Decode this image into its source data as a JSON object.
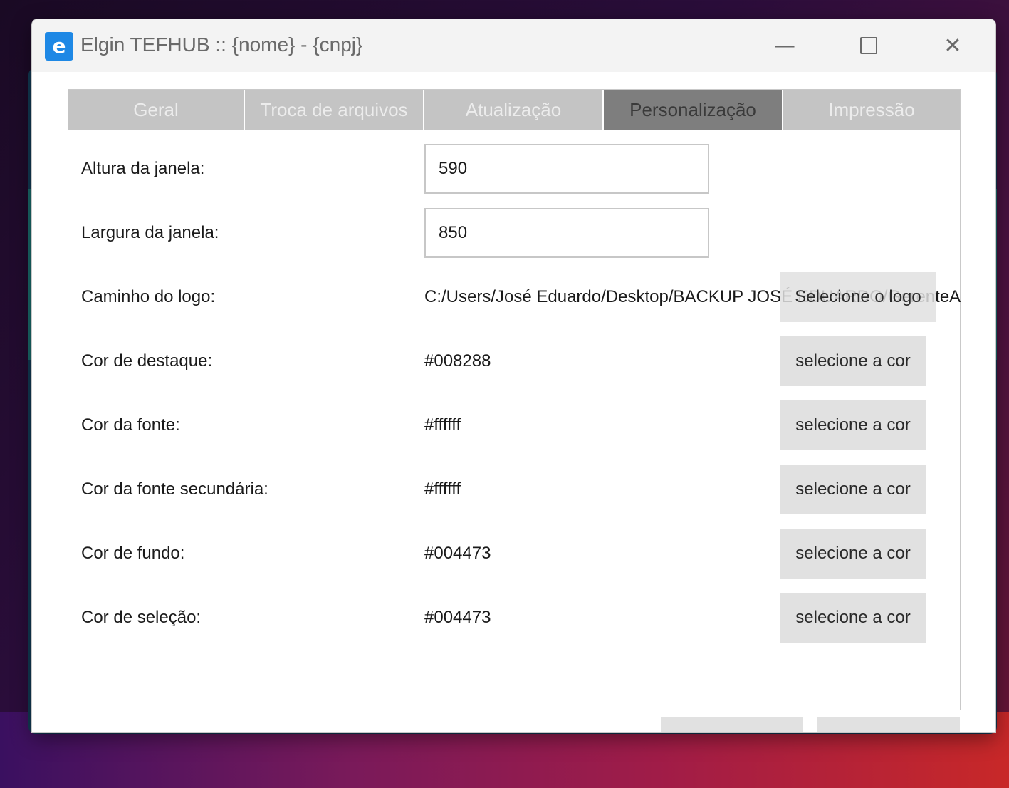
{
  "window": {
    "app_icon_letter": "e",
    "title": "Elgin TEFHUB :: {nome} - {cnpj}",
    "controls": {
      "minimize": "—",
      "close": "✕"
    }
  },
  "tabs": [
    {
      "label": "Geral",
      "active": false
    },
    {
      "label": "Troca de arquivos",
      "active": false
    },
    {
      "label": "Atualização",
      "active": false
    },
    {
      "label": "Personalização",
      "active": true
    },
    {
      "label": "Impressão",
      "active": false
    }
  ],
  "form": {
    "window_height": {
      "label": "Altura da janela:",
      "value": "590"
    },
    "window_width": {
      "label": "Largura da janela:",
      "value": "850"
    },
    "logo_path": {
      "label": "Caminho do logo:",
      "value": "C:/Users/José Eduardo/Desktop/BACKUP JOSÉ EDUARDO/GerenteAqu",
      "button": "Selecione o logo"
    },
    "highlight_color": {
      "label": "Cor de destaque:",
      "value": "#008288",
      "button": "selecione a cor"
    },
    "font_color": {
      "label": "Cor da fonte:",
      "value": "#ffffff",
      "button": "selecione a cor"
    },
    "secondary_font_color": {
      "label": "Cor da fonte secundária:",
      "value": "#ffffff",
      "button": "selecione a cor"
    },
    "background_color": {
      "label": "Cor de fundo:",
      "value": "#004473",
      "button": "selecione a cor"
    },
    "selection_color": {
      "label": "Cor de seleção:",
      "value": "#004473",
      "button": "selecione a cor"
    }
  },
  "colors": {
    "accent_icon": "#1e88e5",
    "tab_inactive": "#c4c4c4",
    "tab_active": "#7e7e7e",
    "button_bg": "#e1e1e1"
  }
}
